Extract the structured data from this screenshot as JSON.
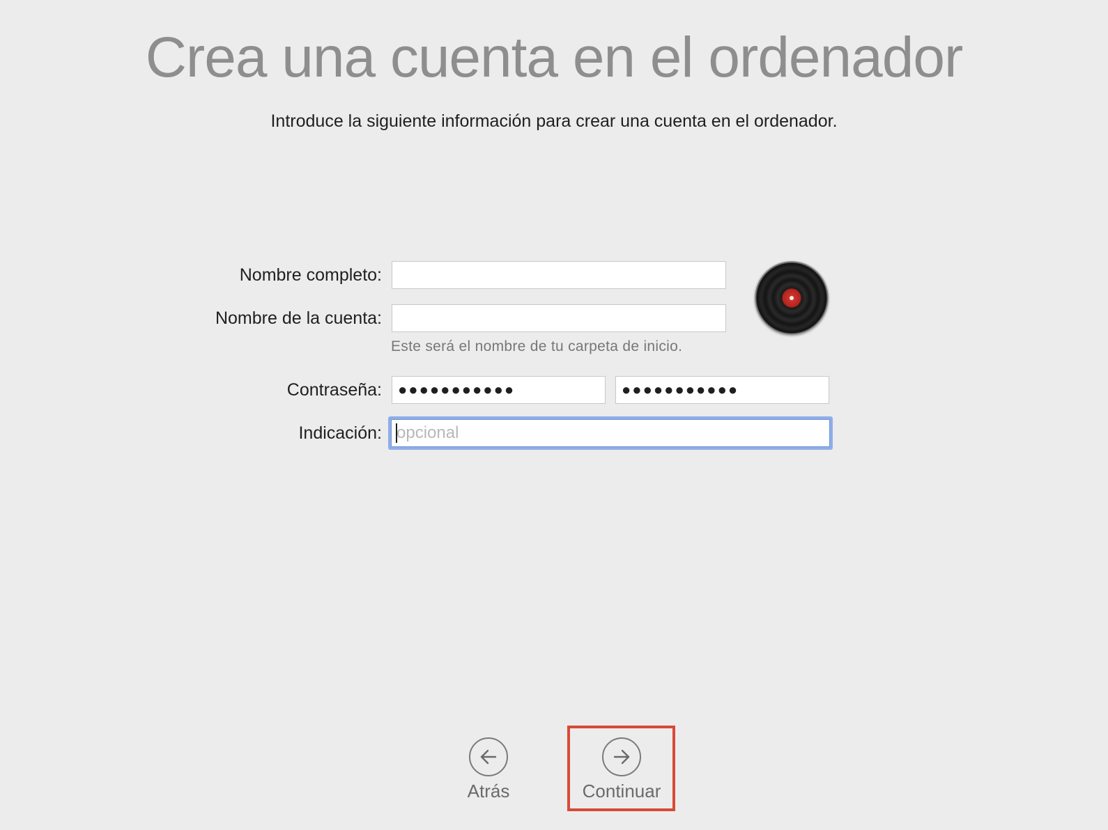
{
  "header": {
    "title": "Crea una cuenta en el ordenador",
    "subtitle": "Introduce la siguiente información para crear una cuenta en el ordenador."
  },
  "form": {
    "full_name": {
      "label": "Nombre completo:",
      "value": ""
    },
    "account_name": {
      "label": "Nombre de la cuenta:",
      "value": "",
      "hint": "Este será el nombre de tu carpeta de inicio."
    },
    "password": {
      "label": "Contraseña:",
      "value": "●●●●●●●●●●●",
      "verify_value": "●●●●●●●●●●●"
    },
    "hint_field": {
      "label": "Indicación:",
      "value": "",
      "placeholder": "opcional"
    }
  },
  "avatar": {
    "icon": "vinyl-record-icon"
  },
  "navigation": {
    "back_label": "Atrás",
    "continue_label": "Continuar",
    "highlight_color": "#d84a37"
  }
}
